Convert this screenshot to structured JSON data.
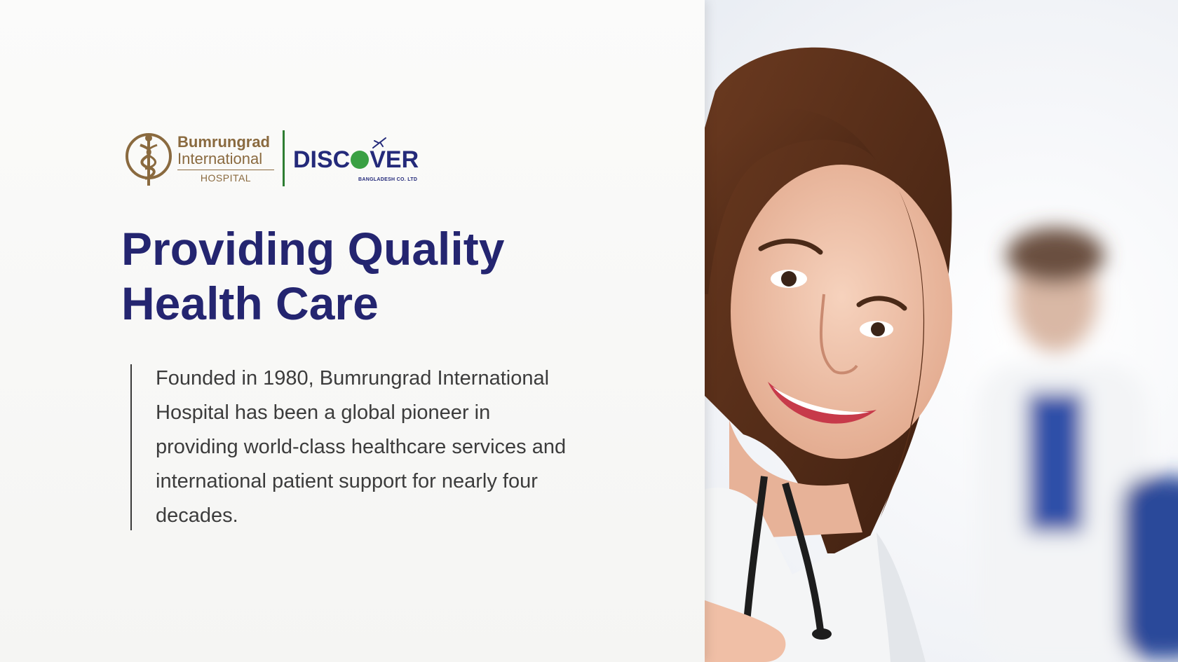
{
  "logos": {
    "hospital": {
      "name_line1": "Bumrungrad",
      "name_line2": "International",
      "name_line3": "HOSPITAL",
      "color": "#8a6a3f"
    },
    "partner": {
      "name_left": "DISC",
      "name_right": "VER",
      "subtitle": "BANGLADESH CO. LTD",
      "color": "#242a7a",
      "accent": "#3aa043"
    },
    "divider_color": "#2e7d32"
  },
  "hero": {
    "title_line1": "Providing Quality",
    "title_line2": "Health Care",
    "title_color": "#242570",
    "description": "Founded in 1980, Bumrungrad International Hospital has been a global pioneer in providing world-class healthcare services and international patient support for nearly four decades."
  },
  "image": {
    "subject": "smiling-doctor-pointing-icon",
    "background_subject": "blurred-doctor-icon"
  }
}
